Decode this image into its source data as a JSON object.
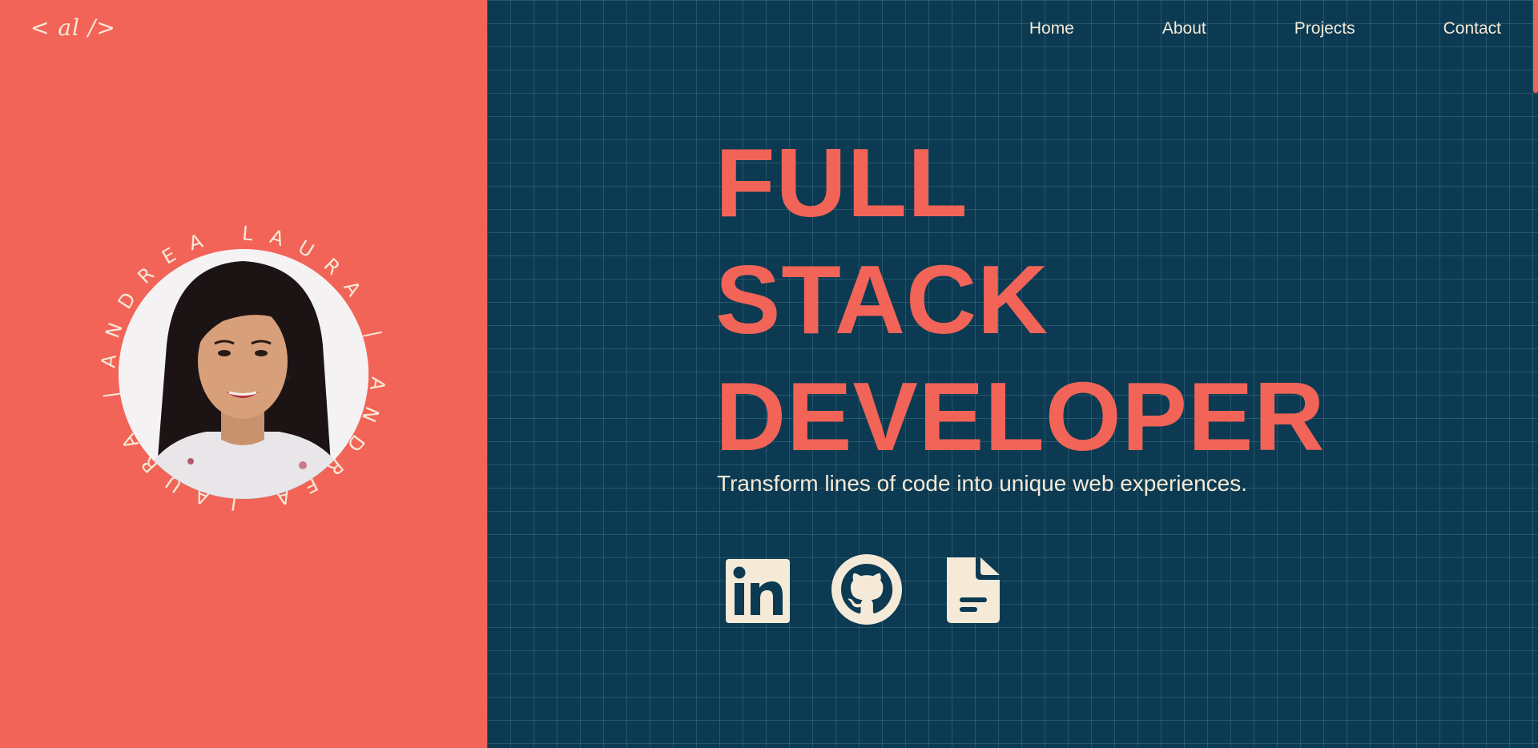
{
  "brand": {
    "logo_text": "< al />"
  },
  "profile": {
    "ring_text": "ANDREA LAURA | ANDREA LAURA | ",
    "photo_alt": "Andrea Laura"
  },
  "nav": {
    "items": [
      {
        "label": "Home"
      },
      {
        "label": "About"
      },
      {
        "label": "Projects"
      },
      {
        "label": "Contact"
      }
    ]
  },
  "hero": {
    "line1": "FULL",
    "line2": "STACK",
    "line3": "DEVELOPER",
    "tagline": "Transform lines of code into unique web experiences."
  },
  "socials": [
    {
      "icon": "linkedin-icon"
    },
    {
      "icon": "github-icon"
    },
    {
      "icon": "document-icon"
    }
  ],
  "colors": {
    "accent": "#f26457",
    "background": "#0b3a52",
    "text": "#f5ead8"
  }
}
